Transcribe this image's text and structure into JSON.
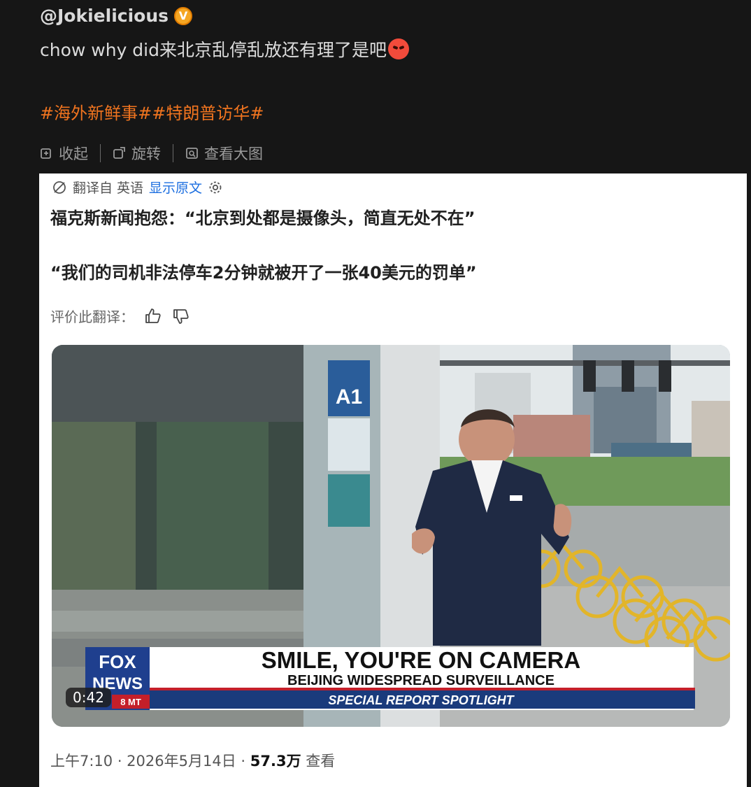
{
  "post": {
    "author": "@Jokielicious",
    "badge": "V",
    "text": "chow why did来北京乱停乱放还有理了是吧",
    "hashtags": "#海外新鲜事##特朗普访华#"
  },
  "actions": {
    "collapse": "收起",
    "rotate": "旋转",
    "view_large": "查看大图"
  },
  "card": {
    "translated_from": "翻译自 英语",
    "show_original": "显示原文",
    "line1": "福克斯新闻抱怨：“北京到处都是摄像头，简直无处不在”",
    "line2": "“我们的司机非法停车2分钟就被开了一张40美元的罚单”",
    "rate_label": "评价此翻译：",
    "timestamp_prefix": "上午7:10 · 2026年5月14日 · ",
    "views": "57.3万",
    "views_suffix": " 查看"
  },
  "video": {
    "duration": "0:42",
    "headline": "SMILE, YOU'RE ON CAMERA",
    "subheadline": "BEIJING WIDESPREAD SURVEILLANCE",
    "segment": "SPECIAL REPORT SPOTLIGHT",
    "logo_top": "FOX",
    "logo_bottom": "NEWS",
    "time_tag": "8 MT",
    "station_sign": "A1"
  }
}
